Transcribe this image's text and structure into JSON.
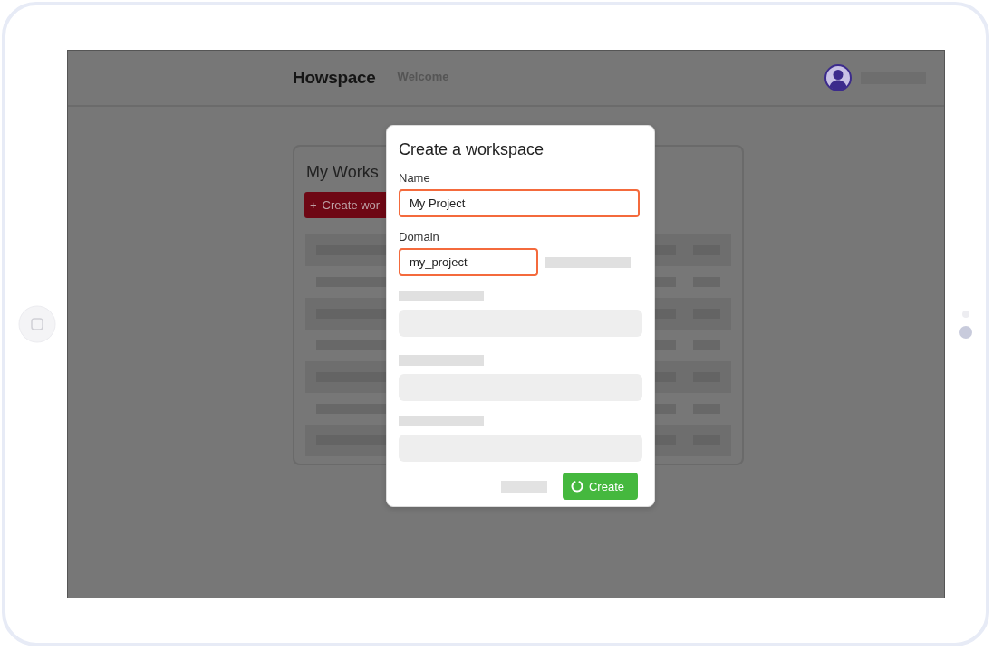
{
  "header": {
    "logo": "Howspace",
    "nav": [
      {
        "label": "Welcome",
        "selected": false
      }
    ]
  },
  "card": {
    "title": "My Works",
    "button": {
      "icon": "+",
      "label": "Create wor"
    }
  },
  "dialog": {
    "title": "Create a workspace",
    "fields": [
      {
        "label": "Name",
        "value": "My Project",
        "highlighted": true,
        "kind": "wide"
      },
      {
        "label": "Domain",
        "value": "my_project",
        "highlighted": true,
        "kind": "short"
      }
    ],
    "submit": {
      "label": "Create",
      "loading": true
    }
  }
}
